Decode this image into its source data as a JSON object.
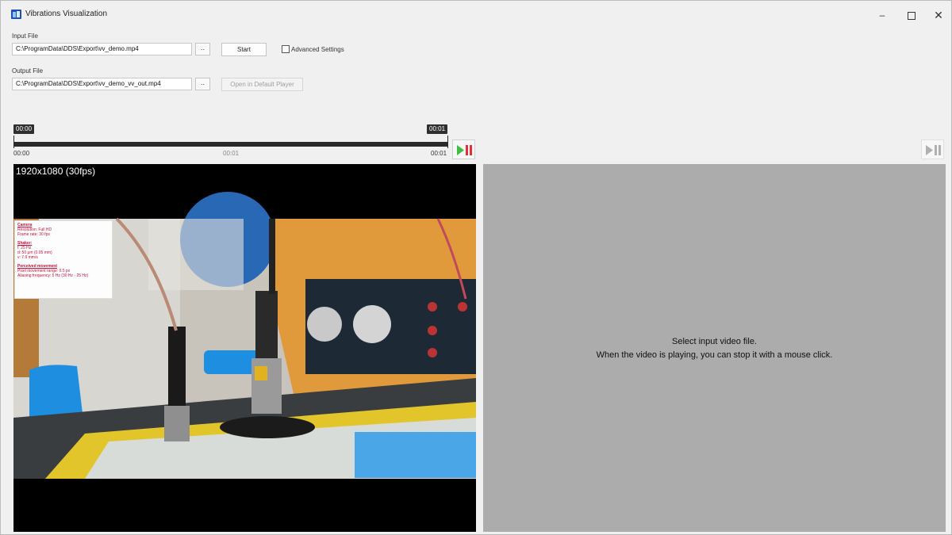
{
  "window": {
    "title": "Vibrations Visualization",
    "controls": {
      "minimize": "–",
      "close": "✕"
    }
  },
  "input": {
    "label": "Input File",
    "value": "C:\\ProgramData\\DDS\\Export\\vv_demo.mp4",
    "browse": "..",
    "start": "Start",
    "advanced": "Advanced Settings"
  },
  "output": {
    "label": "Output File",
    "value": "C:\\ProgramData\\DDS\\Export\\vv_demo_vv_out.mp4",
    "browse": "..",
    "open": "Open in Default Player"
  },
  "timeline": {
    "start_chip": "00:00",
    "end_chip": "00:01",
    "start": "00:00",
    "mid": "00:01",
    "end": "00:01"
  },
  "video": {
    "resolution": "1920x1080 (30fps)"
  },
  "overlay": {
    "camera_title": "Camera",
    "camera_res": "Resolution: Full HD",
    "camera_fps": "Frame rate: 30 fps",
    "shaker_title": "Shaker:",
    "shaker_f": "f: 25 Hz",
    "shaker_d": "d: 50 μm (0.05 mm)",
    "shaker_v": "v: 7.9 mm/s",
    "perceived_title": "Perceived movement",
    "pixel_range": "Pixel movement range: 0.5 px",
    "aliasing": "Aliasing frequency: 5 Hz (30 Hz - 25 Hz)"
  },
  "preview": {
    "hint_line1": "Select input video file.",
    "hint_line2": "When the video is playing, you can stop it with a mouse click."
  },
  "colors": {
    "play_green": "#3fbf3f",
    "pause_red": "#e0303a",
    "panel_gray": "#acacac"
  },
  "icons": {
    "play_pause": "play-pause-icon",
    "app": "app-icon"
  }
}
